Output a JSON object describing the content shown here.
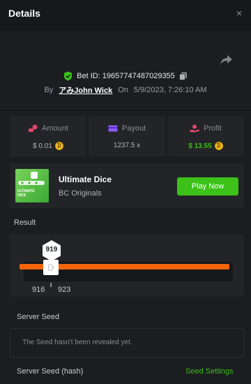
{
  "header": {
    "title": "Details",
    "close_label": "×"
  },
  "bet": {
    "id_label": "Bet ID:",
    "id_value": "19657747487029355",
    "by_label": "By",
    "username": "アみJohn Wick",
    "on_label": "On",
    "datetime": "5/9/2023, 7:26:10 AM"
  },
  "stats": [
    {
      "label": "Amount",
      "value": "$ 0.01",
      "has_coin": true
    },
    {
      "label": "Payout",
      "value": "1237.5 x",
      "has_coin": false
    },
    {
      "label": "Profit",
      "value": "$ 13.55",
      "has_coin": true
    }
  ],
  "game": {
    "name": "Ultimate Dice",
    "provider": "BC Originals",
    "thumb_text": "ULTIMATE DICE",
    "play_label": "Play Now"
  },
  "result": {
    "section_label": "Result",
    "value": "919",
    "range_low": "916",
    "range_high": "923"
  },
  "seeds": {
    "server_seed_label": "Server Seed",
    "server_seed_text": "The Seed hasn't been revealed yet.",
    "server_seed_hash_label": "Server Seed (hash)",
    "seed_settings_label": "Seed Settings"
  },
  "colors": {
    "accent_green": "#3bc117",
    "bar_orange": "#f3650b",
    "coin_gold": "#f6c722"
  }
}
